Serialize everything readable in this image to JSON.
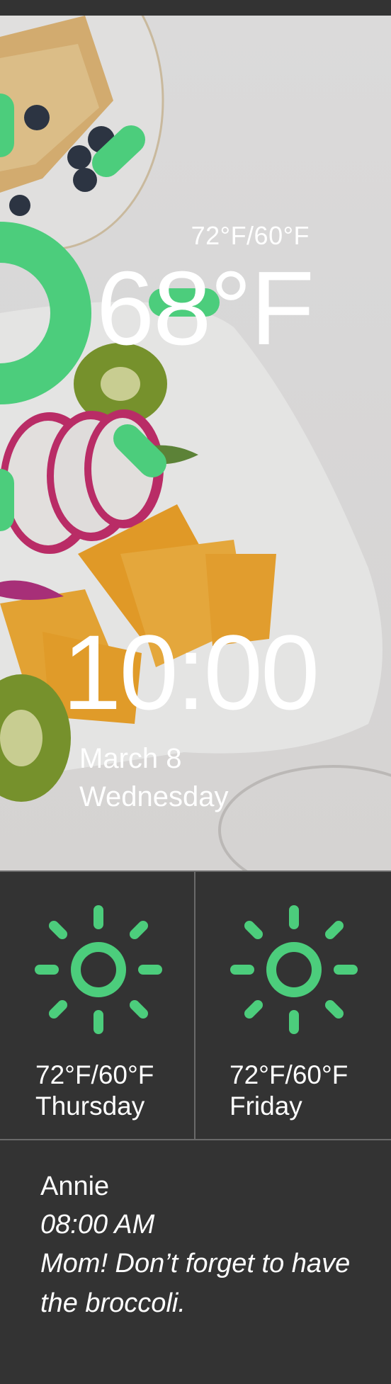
{
  "colors": {
    "accent": "#4ccd7c",
    "panel_background": "#333333",
    "divider": "#6a6a6a",
    "text": "#ffffff"
  },
  "current_weather": {
    "icon": "sun-icon",
    "range": "72°F/60°F",
    "temperature": "68°F"
  },
  "clock": {
    "time": "10:00",
    "date": "March 8",
    "weekday": "Wednesday"
  },
  "forecast": [
    {
      "icon": "sun-icon",
      "range": "72°F/60°F",
      "day": "Thursday"
    },
    {
      "icon": "sun-icon",
      "range": "72°F/60°F",
      "day": "Friday"
    }
  ],
  "message": {
    "sender": "Annie",
    "time": "08:00 AM",
    "text": "Mom! Don’t forget to have the broccoli."
  }
}
